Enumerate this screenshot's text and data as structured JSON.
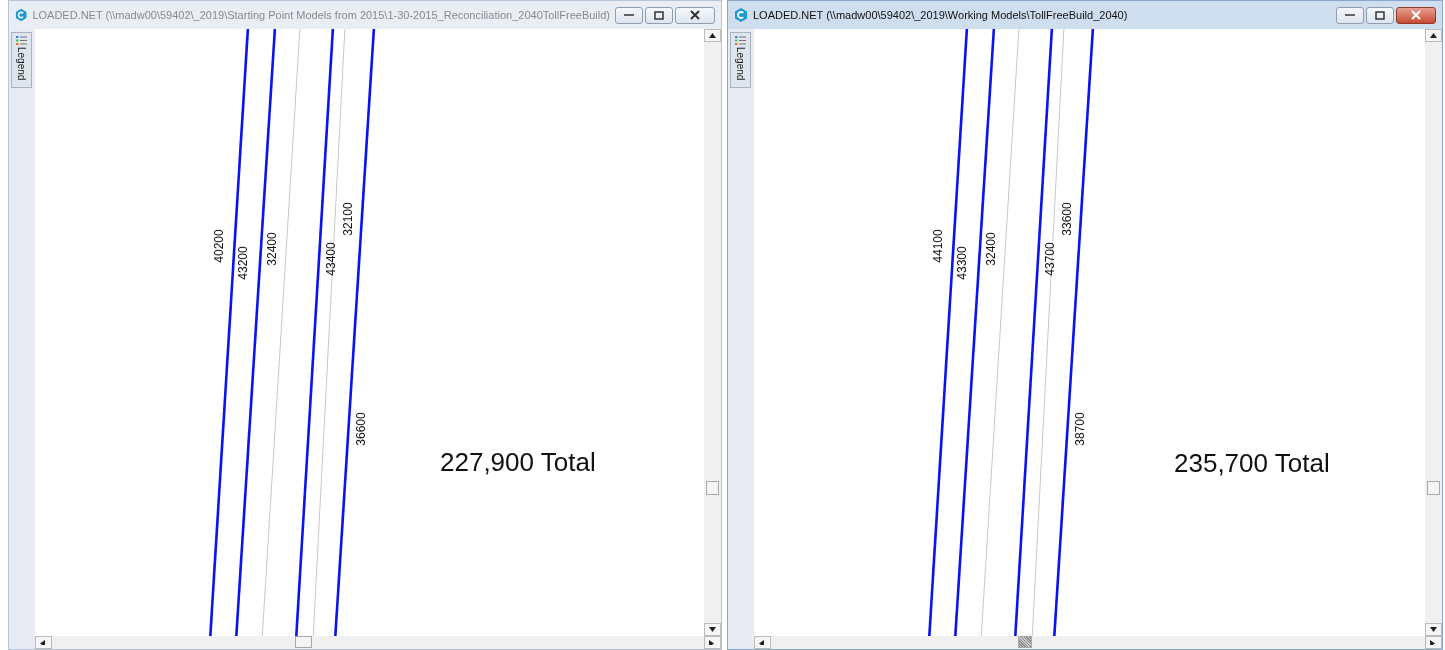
{
  "windows": [
    {
      "title": "LOADED.NET (\\\\madw00\\59402\\_2019\\Starting Point Models from 2015\\1-30-2015_Reconciliation_2040TollFreeBuild)",
      "active": false,
      "legend_tab": "Legend",
      "link_labels": [
        "40200",
        "43200",
        "32400",
        "43400",
        "32100",
        "36600"
      ],
      "total": "227,900 Total"
    },
    {
      "title": "LOADED.NET (\\\\madw00\\59402\\_2019\\Working Models\\TollFreeBuild_2040)",
      "active": true,
      "legend_tab": "Legend",
      "link_labels": [
        "44100",
        "43300",
        "32400",
        "43700",
        "33600",
        "38700"
      ],
      "total": "235,700 Total"
    }
  ]
}
